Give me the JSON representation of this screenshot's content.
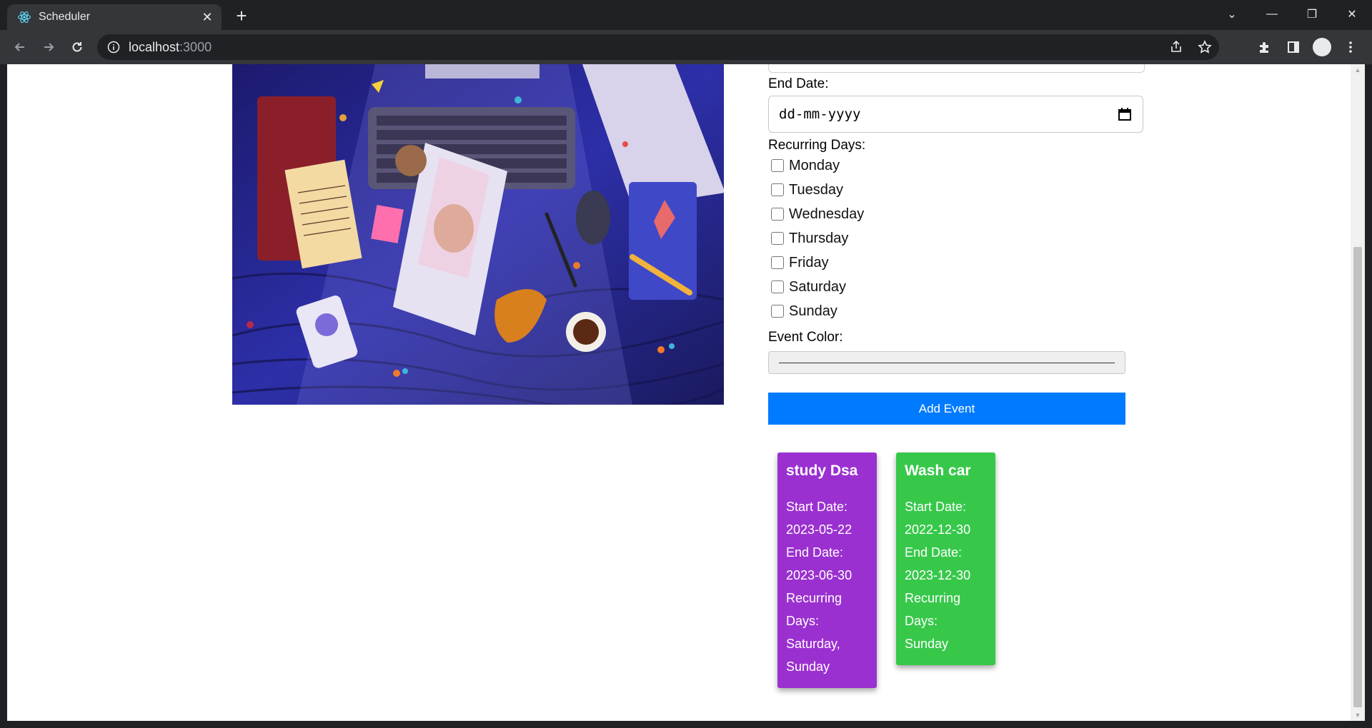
{
  "browser": {
    "tab_title": "Scheduler",
    "url_host": "localhost",
    "url_port": ":3000"
  },
  "form": {
    "end_date_label": "End Date:",
    "end_date_placeholder": "dd-mm-yyyy",
    "recurring_label": "Recurring Days:",
    "days": [
      "Monday",
      "Tuesday",
      "Wednesday",
      "Thursday",
      "Friday",
      "Saturday",
      "Sunday"
    ],
    "color_label": "Event Color:",
    "add_button": "Add Event"
  },
  "events": [
    {
      "title": "study Dsa",
      "color": "#9b30d0",
      "start_label": "Start Date:",
      "start": "2023-05-22",
      "end_label": "End Date:",
      "end": "2023-06-30",
      "days_label_1": "Recurring",
      "days_label_2": "Days:",
      "days_value_1": "Saturday,",
      "days_value_2": "Sunday"
    },
    {
      "title": "Wash car",
      "color": "#37c84a",
      "start_label": "Start Date:",
      "start": "2022-12-30",
      "end_label": "End Date:",
      "end": "2023-12-30",
      "days_label_1": "Recurring",
      "days_label_2": "Days:",
      "days_value_1": "Sunday"
    }
  ],
  "colors": {
    "add_button": "#007bff",
    "browser_frame": "#202124",
    "toolbar": "#35363a"
  }
}
